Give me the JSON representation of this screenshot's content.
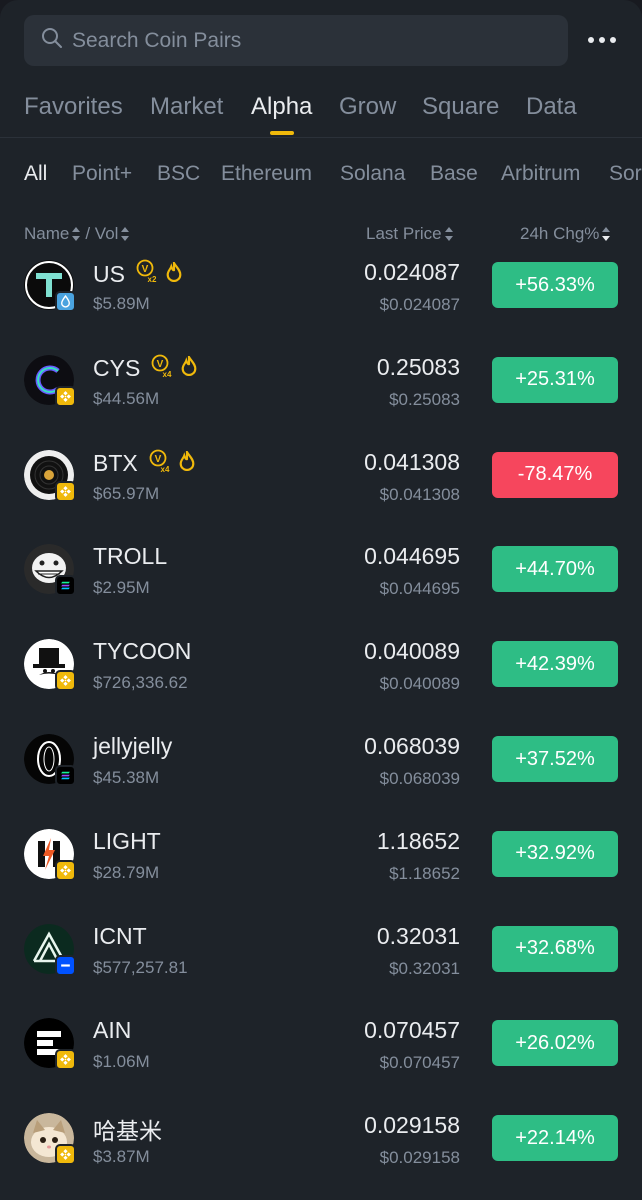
{
  "search": {
    "placeholder": "Search Coin Pairs"
  },
  "main_tabs": [
    "Favorites",
    "Market",
    "Alpha",
    "Grow",
    "Square",
    "Data"
  ],
  "active_main_tab": "Alpha",
  "chain_tabs": [
    "All",
    "Point+",
    "BSC",
    "Ethereum",
    "Solana",
    "Base",
    "Arbitrum",
    "Sor"
  ],
  "active_chain_tab": "All",
  "columns": {
    "name": "Name",
    "sep": "/ Vol",
    "price": "Last Price",
    "change": "24h Chg%"
  },
  "colors": {
    "up": "#2ebd85",
    "down": "#f6465d",
    "accent": "#f0b90b",
    "bg": "#1e2329"
  },
  "coins": [
    {
      "name": "US",
      "vol": "$5.89M",
      "price": "0.024087",
      "usd": "$0.024087",
      "change": "+56.33%",
      "dir": "up",
      "multiplier": "x2",
      "chain": "water-drop-icon",
      "logo": "us-logo-icon"
    },
    {
      "name": "CYS",
      "vol": "$44.56M",
      "price": "0.25083",
      "usd": "$0.25083",
      "change": "+25.31%",
      "dir": "up",
      "multiplier": "x4",
      "chain": "bsc-icon",
      "logo": "cys-logo-icon"
    },
    {
      "name": "BTX",
      "vol": "$65.97M",
      "price": "0.041308",
      "usd": "$0.041308",
      "change": "-78.47%",
      "dir": "down",
      "multiplier": "x4",
      "chain": "bsc-icon",
      "logo": "btx-logo-icon"
    },
    {
      "name": "TROLL",
      "vol": "$2.95M",
      "price": "0.044695",
      "usd": "$0.044695",
      "change": "+44.70%",
      "dir": "up",
      "chain": "solana-icon",
      "logo": "troll-logo-icon"
    },
    {
      "name": "TYCOON",
      "vol": "$726,336.62",
      "price": "0.040089",
      "usd": "$0.040089",
      "change": "+42.39%",
      "dir": "up",
      "chain": "bsc-icon",
      "logo": "tycoon-logo-icon"
    },
    {
      "name": "jellyjelly",
      "vol": "$45.38M",
      "price": "0.068039",
      "usd": "$0.068039",
      "change": "+37.52%",
      "dir": "up",
      "chain": "solana-icon",
      "logo": "jellyjelly-logo-icon"
    },
    {
      "name": "LIGHT",
      "vol": "$28.79M",
      "price": "1.18652",
      "usd": "$1.18652",
      "change": "+32.92%",
      "dir": "up",
      "chain": "bsc-icon",
      "logo": "light-logo-icon"
    },
    {
      "name": "ICNT",
      "vol": "$577,257.81",
      "price": "0.32031",
      "usd": "$0.32031",
      "change": "+32.68%",
      "dir": "up",
      "chain": "base-icon",
      "logo": "icnt-logo-icon"
    },
    {
      "name": "AIN",
      "vol": "$1.06M",
      "price": "0.070457",
      "usd": "$0.070457",
      "change": "+26.02%",
      "dir": "up",
      "chain": "bsc-icon",
      "logo": "ain-logo-icon"
    },
    {
      "name": "哈基米",
      "vol": "$3.87M",
      "price": "0.029158",
      "usd": "$0.029158",
      "change": "+22.14%",
      "dir": "up",
      "chain": "bsc-icon",
      "logo": "hajimi-logo-icon"
    }
  ]
}
